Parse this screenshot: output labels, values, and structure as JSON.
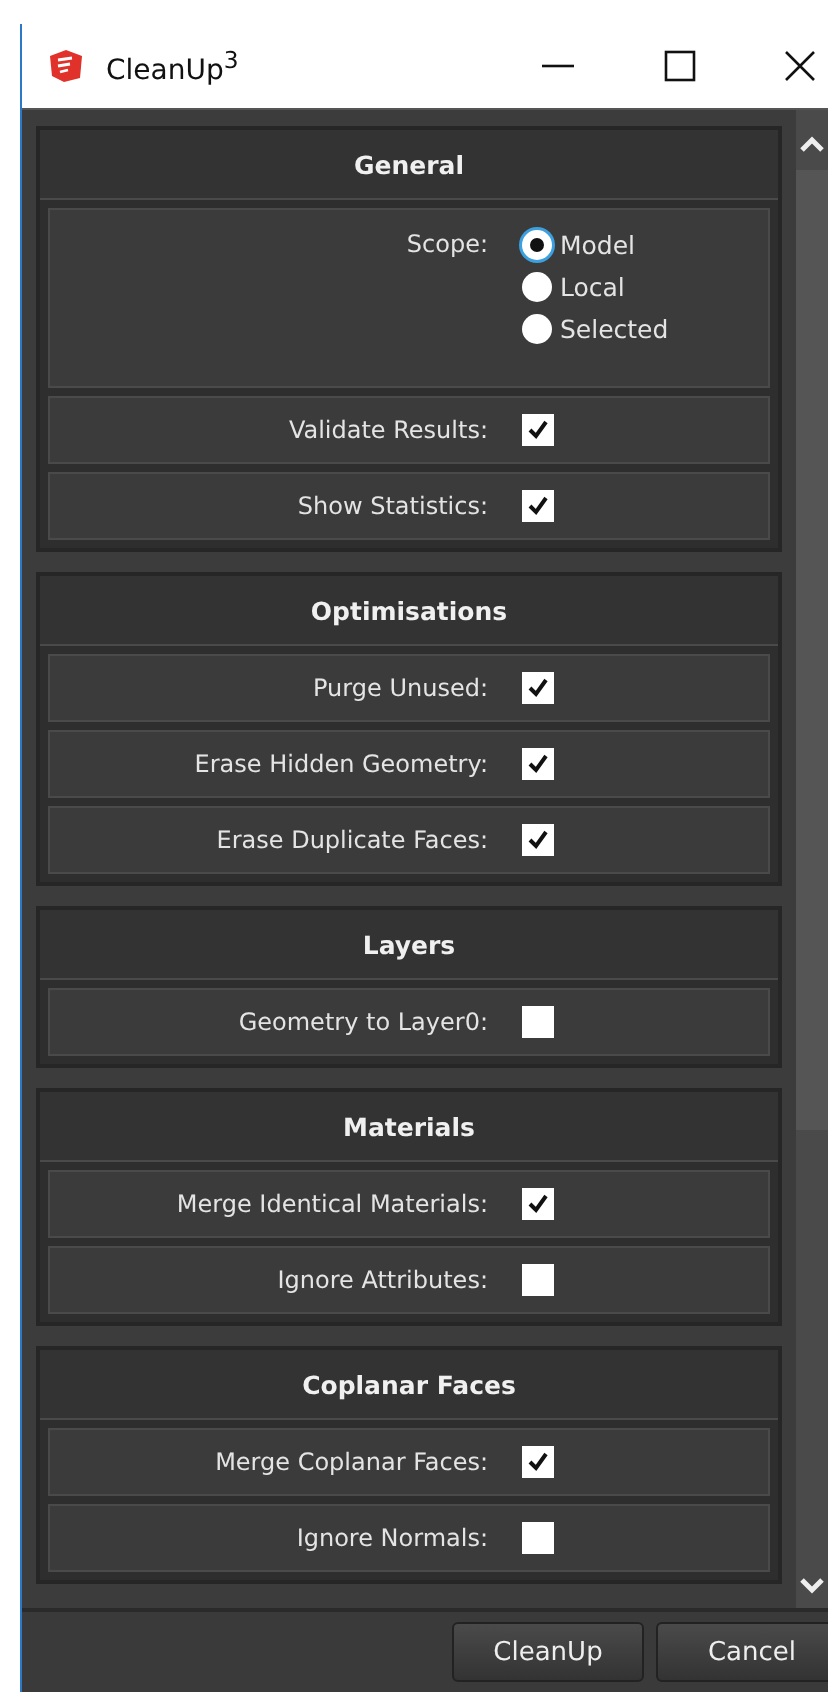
{
  "window": {
    "title": "CleanUp$^{3}$"
  },
  "sections": [
    {
      "title": "General",
      "rows": [
        {
          "kind": "radio",
          "label": "Scope:",
          "options": [
            {
              "label": "Model",
              "selected": true
            },
            {
              "label": "Local",
              "selected": false
            },
            {
              "label": "Selected",
              "selected": false
            }
          ]
        },
        {
          "kind": "checkbox",
          "label": "Validate Results:",
          "checked": true
        },
        {
          "kind": "checkbox",
          "label": "Show Statistics:",
          "checked": true
        }
      ]
    },
    {
      "title": "Optimisations",
      "rows": [
        {
          "kind": "checkbox",
          "label": "Purge Unused:",
          "checked": true
        },
        {
          "kind": "checkbox",
          "label": "Erase Hidden Geometry:",
          "checked": true
        },
        {
          "kind": "checkbox",
          "label": "Erase Duplicate Faces:",
          "checked": true
        }
      ]
    },
    {
      "title": "Layers",
      "rows": [
        {
          "kind": "checkbox",
          "label": "Geometry to Layer0:",
          "checked": false
        }
      ]
    },
    {
      "title": "Materials",
      "rows": [
        {
          "kind": "checkbox",
          "label": "Merge Identical Materials:",
          "checked": true
        },
        {
          "kind": "checkbox",
          "label": "Ignore Attributes:",
          "checked": false
        }
      ]
    },
    {
      "title": "Coplanar Faces",
      "rows": [
        {
          "kind": "checkbox",
          "label": "Merge Coplanar Faces:",
          "checked": true
        },
        {
          "kind": "checkbox",
          "label": "Ignore Normals:",
          "checked": false
        }
      ]
    }
  ],
  "buttons": [
    "CleanUp",
    "Cancel"
  ]
}
